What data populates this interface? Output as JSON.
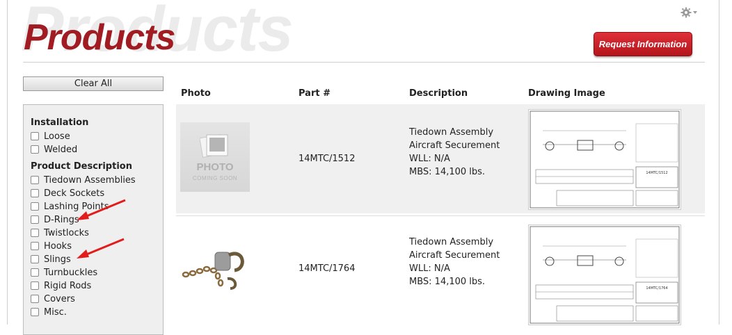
{
  "header": {
    "watermark": "Products",
    "title": "Products",
    "request_button": "Request Information"
  },
  "filters": {
    "clear_label": "Clear All",
    "groups": [
      {
        "title": "Installation",
        "options": [
          "Loose",
          "Welded"
        ]
      },
      {
        "title": "Product Description",
        "options": [
          "Tiedown Assemblies",
          "Deck Sockets",
          "Lashing Points",
          "D-Rings",
          "Twistlocks",
          "Hooks",
          "Slings",
          "Turnbuckles",
          "Rigid Rods",
          "Covers",
          "Misc."
        ]
      }
    ]
  },
  "table": {
    "columns": [
      "Photo",
      "Part #",
      "Description",
      "Drawing Image"
    ],
    "rows": [
      {
        "photo_placeholder_line1": "PHOTO",
        "photo_placeholder_line2": "COMING SOON",
        "part": "14MTC/1512",
        "desc": [
          "Tiedown Assembly",
          "Aircraft Securement",
          "WLL: N/A",
          "MBS: 14,100 lbs."
        ],
        "drawing_title": "14MTC/1512"
      },
      {
        "part": "14MTC/1764",
        "desc": [
          "Tiedown Assembly",
          "Aircraft Securement",
          "WLL: N/A",
          "MBS: 14,100 lbs."
        ],
        "drawing_title": "14MTC/1764"
      }
    ]
  },
  "colors": {
    "brand": "#a01c22",
    "annotation_arrow": "#e21c1c"
  },
  "icons": [
    "gear-icon",
    "arrow-annotation"
  ]
}
